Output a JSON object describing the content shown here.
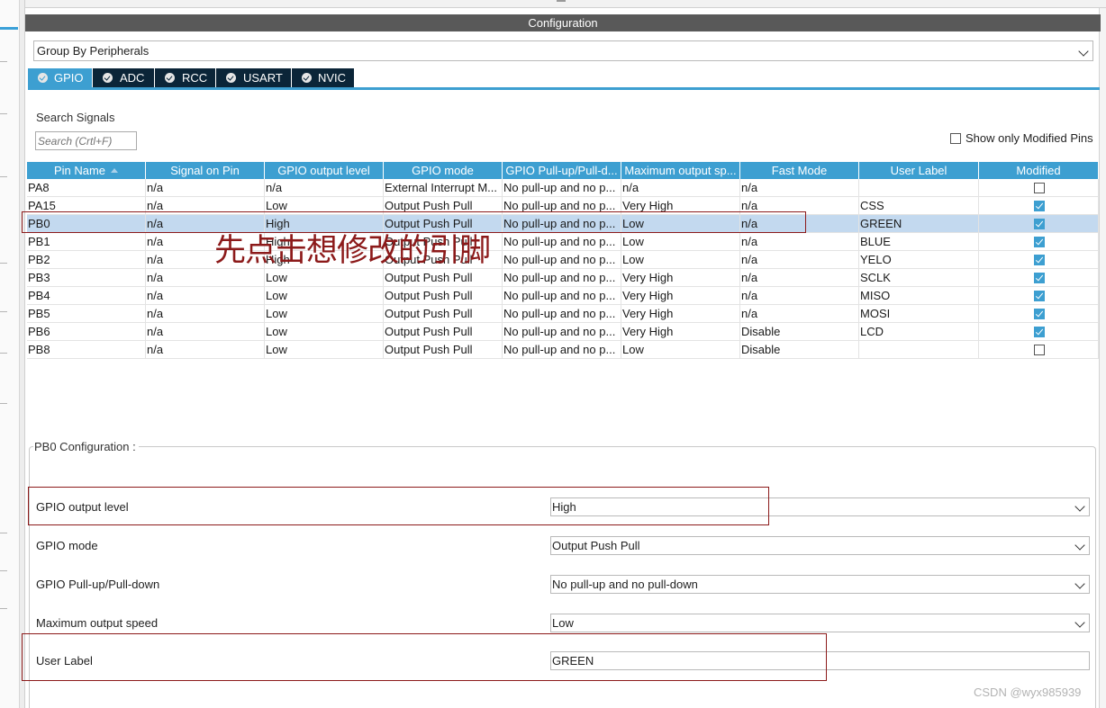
{
  "configuration_title": "Configuration",
  "group_select": {
    "value": "Group By Peripherals"
  },
  "tabs": [
    {
      "label": "GPIO",
      "active": true
    },
    {
      "label": "ADC",
      "active": false
    },
    {
      "label": "RCC",
      "active": false
    },
    {
      "label": "USART",
      "active": false
    },
    {
      "label": "NVIC",
      "active": false
    }
  ],
  "search": {
    "label": "Search Signals",
    "placeholder": "Search (Crtl+F)"
  },
  "show_modified": {
    "label": "Show only Modified Pins",
    "checked": false
  },
  "table": {
    "columns": [
      "Pin Name",
      "Signal on Pin",
      "GPIO output level",
      "GPIO mode",
      "GPIO Pull-up/Pull-d...",
      "Maximum output sp...",
      "Fast Mode",
      "User Label",
      "Modified"
    ],
    "rows": [
      {
        "pin": "PA8",
        "signal": "n/a",
        "level": "n/a",
        "mode": "External Interrupt M...",
        "pull": "No pull-up and no p...",
        "speed": "n/a",
        "fast": "n/a",
        "label": "",
        "modified": false,
        "selected": false
      },
      {
        "pin": "PA15",
        "signal": "n/a",
        "level": "Low",
        "mode": "Output Push Pull",
        "pull": "No pull-up and no p...",
        "speed": "Very High",
        "fast": "n/a",
        "label": "CSS",
        "modified": true,
        "selected": false
      },
      {
        "pin": "PB0",
        "signal": "n/a",
        "level": "High",
        "mode": "Output Push Pull",
        "pull": "No pull-up and no p...",
        "speed": "Low",
        "fast": "n/a",
        "label": "GREEN",
        "modified": true,
        "selected": true
      },
      {
        "pin": "PB1",
        "signal": "n/a",
        "level": "High",
        "mode": "Output Push Pull",
        "pull": "No pull-up and no p...",
        "speed": "Low",
        "fast": "n/a",
        "label": "BLUE",
        "modified": true,
        "selected": false
      },
      {
        "pin": "PB2",
        "signal": "n/a",
        "level": "High",
        "mode": "Output Push Pull",
        "pull": "No pull-up and no p...",
        "speed": "Low",
        "fast": "n/a",
        "label": "YELO",
        "modified": true,
        "selected": false
      },
      {
        "pin": "PB3",
        "signal": "n/a",
        "level": "Low",
        "mode": "Output Push Pull",
        "pull": "No pull-up and no p...",
        "speed": "Very High",
        "fast": "n/a",
        "label": "SCLK",
        "modified": true,
        "selected": false
      },
      {
        "pin": "PB4",
        "signal": "n/a",
        "level": "Low",
        "mode": "Output Push Pull",
        "pull": "No pull-up and no p...",
        "speed": "Very High",
        "fast": "n/a",
        "label": "MISO",
        "modified": true,
        "selected": false
      },
      {
        "pin": "PB5",
        "signal": "n/a",
        "level": "Low",
        "mode": "Output Push Pull",
        "pull": "No pull-up and no p...",
        "speed": "Very High",
        "fast": "n/a",
        "label": "MOSI",
        "modified": true,
        "selected": false
      },
      {
        "pin": "PB6",
        "signal": "n/a",
        "level": "Low",
        "mode": "Output Push Pull",
        "pull": "No pull-up and no p...",
        "speed": "Very High",
        "fast": "Disable",
        "label": "LCD",
        "modified": true,
        "selected": false
      },
      {
        "pin": "PB8",
        "signal": "n/a",
        "level": "Low",
        "mode": "Output Push Pull",
        "pull": "No pull-up and no p...",
        "speed": "Low",
        "fast": "Disable",
        "label": "",
        "modified": false,
        "selected": false
      }
    ]
  },
  "annotation": "先点击想修改的引脚",
  "pin_config": {
    "title": "PB0 Configuration :",
    "fields": [
      {
        "label": "GPIO output level",
        "value": "High",
        "dropdown": true
      },
      {
        "label": "GPIO mode",
        "value": "Output Push Pull",
        "dropdown": true
      },
      {
        "label": "GPIO Pull-up/Pull-down",
        "value": "No pull-up and no pull-down",
        "dropdown": true
      },
      {
        "label": "Maximum output speed",
        "value": "Low",
        "dropdown": true
      },
      {
        "label": "User Label",
        "value": "GREEN",
        "dropdown": false
      }
    ]
  },
  "watermark": "CSDN @wyx985939",
  "colors": {
    "accent": "#3d9fd1",
    "tab_dark": "#0b2538",
    "title_bar": "#595959",
    "selected_row": "#c3d9ef",
    "annotation_red": "#8c1a1a"
  }
}
